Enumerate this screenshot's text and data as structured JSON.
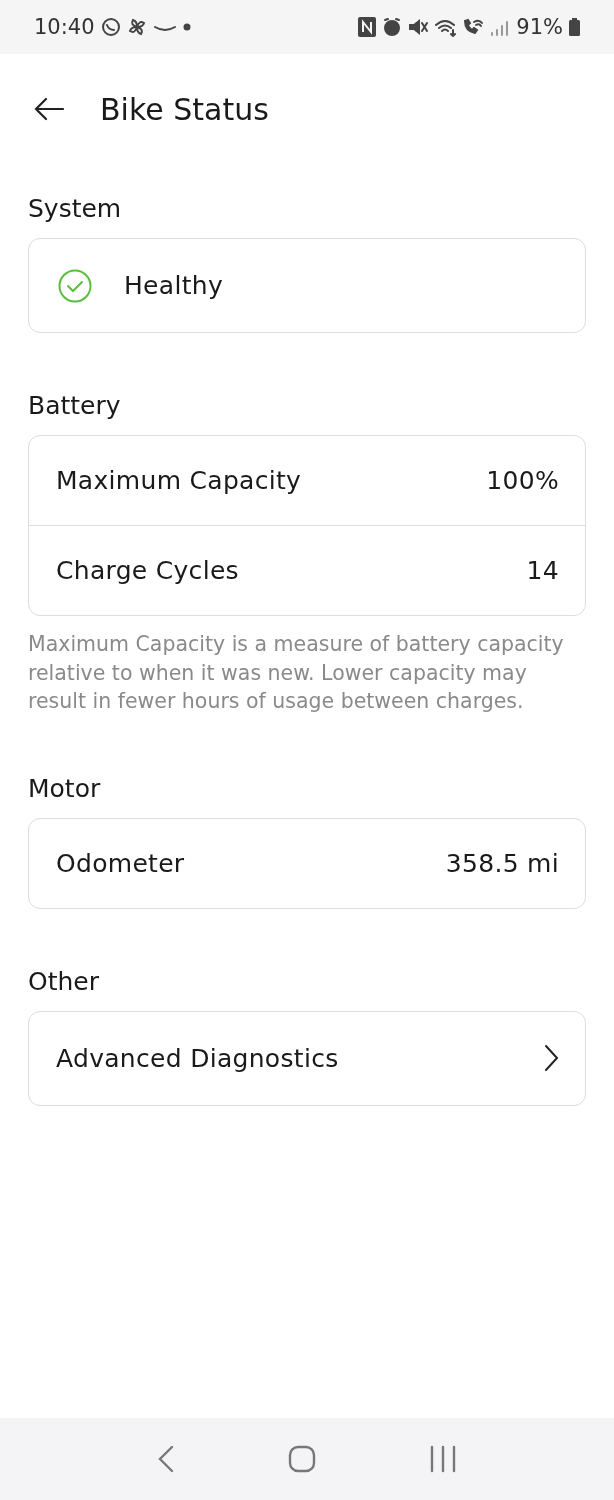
{
  "status_bar": {
    "time": "10:40",
    "battery": "91%"
  },
  "header": {
    "title": "Bike Status"
  },
  "sections": [
    {
      "title": "System",
      "rows": [
        {
          "kind": "status",
          "label": "Healthy"
        }
      ]
    },
    {
      "title": "Battery",
      "rows": [
        {
          "kind": "value",
          "label": "Maximum Capacity",
          "value": "100%"
        },
        {
          "kind": "value",
          "label": "Charge Cycles",
          "value": "14"
        }
      ],
      "note": "Maximum Capacity is a measure of battery capacity relative to when it was new. Lower capacity may result in fewer hours of usage between charges."
    },
    {
      "title": "Motor",
      "rows": [
        {
          "kind": "value",
          "label": "Odometer",
          "value": "358.5 mi"
        }
      ]
    },
    {
      "title": "Other",
      "rows": [
        {
          "kind": "link",
          "label": "Advanced Diagnostics"
        }
      ]
    }
  ]
}
